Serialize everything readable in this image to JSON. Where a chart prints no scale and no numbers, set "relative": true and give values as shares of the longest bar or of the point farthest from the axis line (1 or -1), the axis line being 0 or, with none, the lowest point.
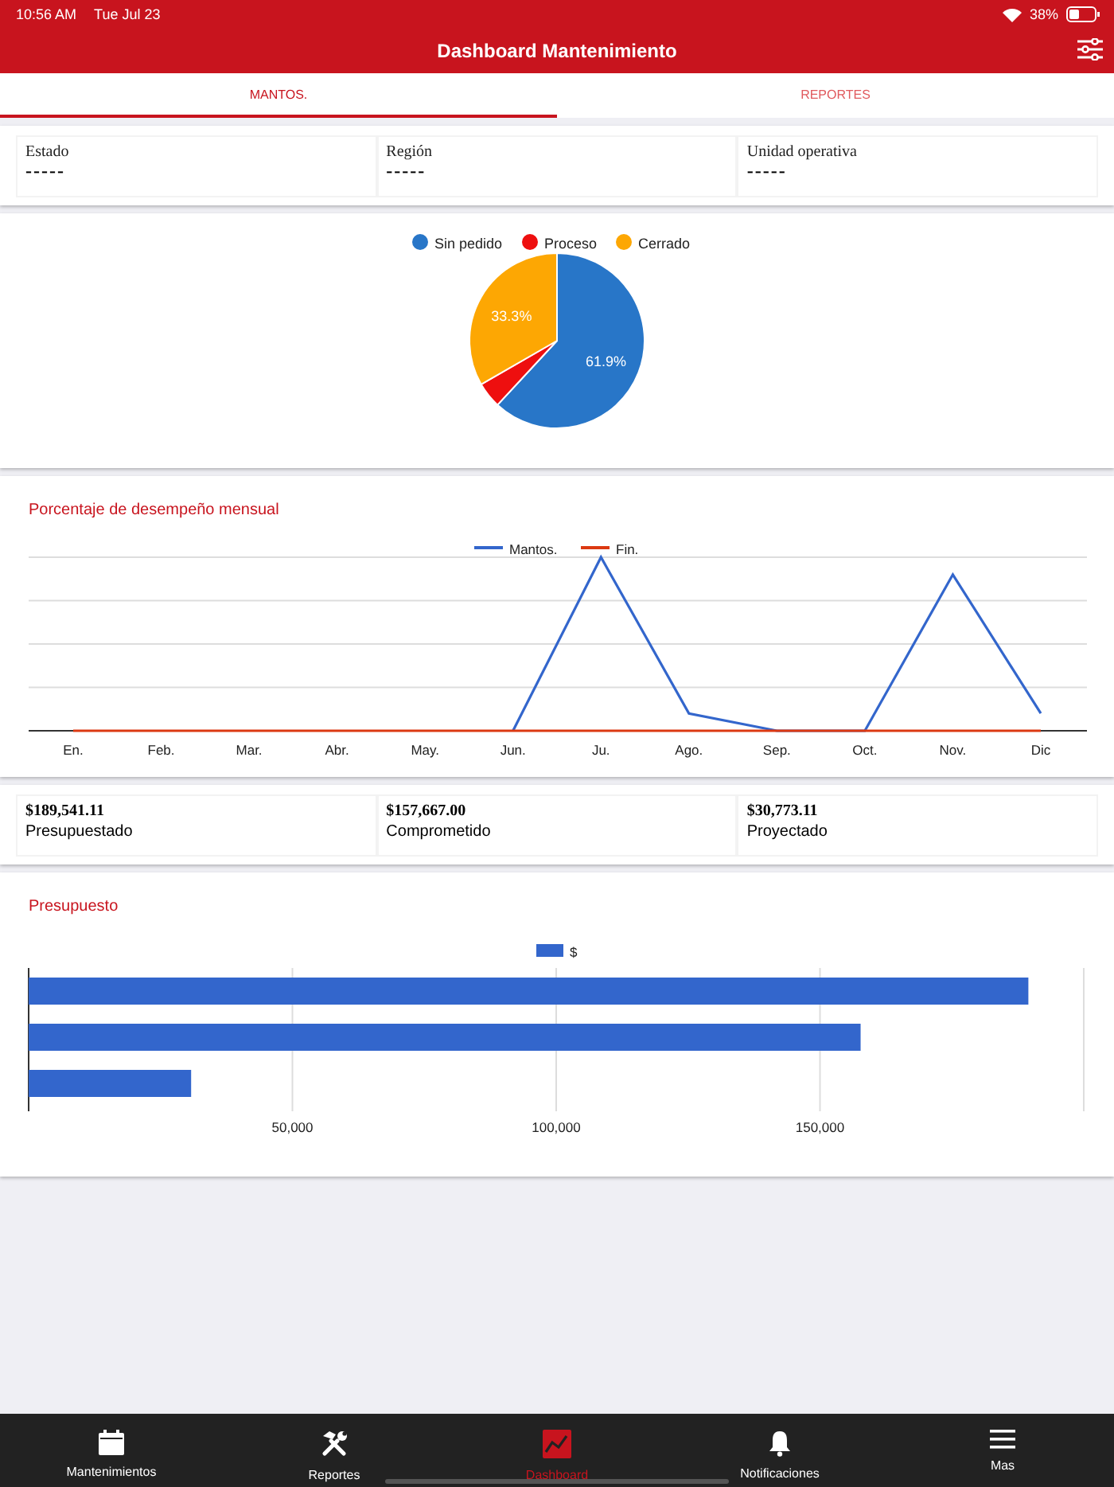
{
  "status_bar": {
    "time": "10:56 AM",
    "date": "Tue Jul 23",
    "battery": "38%"
  },
  "header": {
    "title": "Dashboard Mantenimiento"
  },
  "tabs": [
    {
      "label": "MANTOS.",
      "selected": true
    },
    {
      "label": "REPORTES",
      "selected": false
    }
  ],
  "filters": [
    {
      "label": "Estado",
      "value": "-----"
    },
    {
      "label": "Región",
      "value": "-----"
    },
    {
      "label": "Unidad operativa",
      "value": "-----"
    }
  ],
  "status_chart": {
    "chart_data": {
      "type": "pie",
      "legend": "top",
      "categories": [
        "Sin pedido",
        "Proceso",
        "Cerrado"
      ],
      "values": [
        61.9,
        4.8,
        33.3
      ],
      "colors": [
        "#2876c8",
        "#ee0f0f",
        "#fda703"
      ],
      "value_labels": [
        "61.9%",
        null,
        "33.3%"
      ]
    }
  },
  "performance": {
    "title": "Porcentaje de desempeño mensual",
    "chart_data": {
      "type": "line",
      "categories": [
        "En.",
        "Feb.",
        "Mar.",
        "Abr.",
        "May.",
        "Jun.",
        "Ju.",
        "Ago.",
        "Sep.",
        "Oct.",
        "Nov.",
        "Dic"
      ],
      "relative": true,
      "legend": "top",
      "grid": true,
      "series": [
        {
          "name": "Mantos.",
          "color": "#3366cc",
          "values": [
            null,
            null,
            null,
            null,
            null,
            0,
            1,
            0.1,
            0,
            0,
            0.9,
            0.1
          ]
        },
        {
          "name": "Fin.",
          "color": "#dc3912",
          "values": [
            0,
            0,
            0,
            0,
            0,
            0,
            0,
            0,
            0,
            0,
            0,
            0
          ]
        }
      ]
    }
  },
  "budget_totals": [
    {
      "amount": "$189,541.11",
      "label": "Presupuestado"
    },
    {
      "amount": "$157,667.00",
      "label": "Comprometido"
    },
    {
      "amount": "$30,773.11",
      "label": "Proyectado"
    }
  ],
  "budget": {
    "title": "Presupuesto",
    "chart_data": {
      "type": "bar",
      "orientation": "horizontal",
      "legend": "top",
      "grid": true,
      "xlim": [
        0,
        200000
      ],
      "xticks": [
        {
          "value": 50000,
          "label": "50,000"
        },
        {
          "value": 100000,
          "label": "100,000"
        },
        {
          "value": 150000,
          "label": "150,000"
        }
      ],
      "series": [
        {
          "name": "$",
          "color": "#3366cc",
          "values": [
            189500,
            157700,
            30800
          ]
        }
      ]
    }
  },
  "bottom_nav": [
    {
      "label": "Mantenimientos",
      "selected": false
    },
    {
      "label": "Reportes",
      "selected": false
    },
    {
      "label": "Dashboard",
      "selected": true
    },
    {
      "label": "Notificaciones",
      "selected": false
    },
    {
      "label": "Mas",
      "selected": false
    }
  ]
}
